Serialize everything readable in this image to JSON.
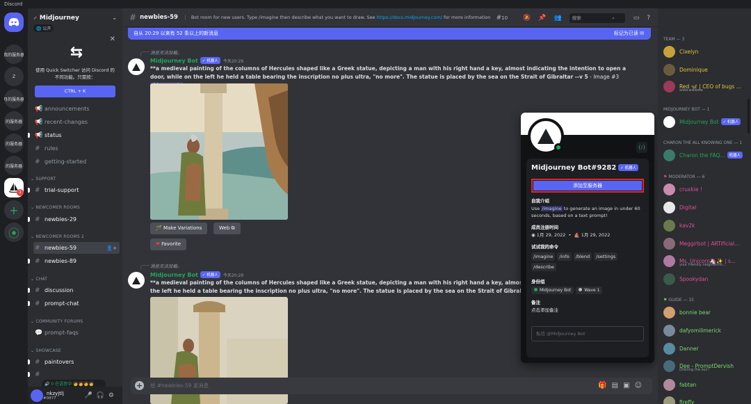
{
  "app": {
    "title": "Discord"
  },
  "rail": {
    "servers": [
      "我的服务器",
      "Z",
      "月的服务器",
      "的服务器",
      "的服务器",
      "的服务器"
    ],
    "active_badge": "1",
    "add": "+",
    "explore": "⦿"
  },
  "guild": {
    "name": "Midjourney",
    "public_tag": "公开",
    "quick_switcher": {
      "text": "使用 Quick Switcher 访问 Discord 的不同功能。只需按：",
      "shortcut": "CTRL + K"
    },
    "channels": [
      {
        "kind": "text",
        "label": "announcements"
      },
      {
        "kind": "text",
        "label": "recent-changes"
      },
      {
        "kind": "text",
        "label": "status"
      },
      {
        "kind": "text",
        "label": "rules"
      },
      {
        "kind": "text",
        "label": "getting-started"
      }
    ],
    "categories": {
      "support": "SUPPORT",
      "newcomer": "NEWCOMER ROOMS",
      "newcomer2": "NEWCOMER ROOMS 2",
      "chat": "CHAT",
      "forums": "COMMUNITY FORUMS",
      "showcase": "SHOWCASE"
    },
    "support_channels": [
      "trial-support"
    ],
    "newcomer_channels": [
      "newbies-29"
    ],
    "newcomer2_channels": [
      "newbies-59",
      "newbies-89"
    ],
    "chat_channels": [
      "discussion",
      "prompt-chat"
    ],
    "forum_channels": [
      "prompt-faqs"
    ],
    "showcase_channels": [
      "paintovers"
    ],
    "voice_status": "0 在语音中"
  },
  "user": {
    "name": "nkzyjtlj",
    "tag": "#0877"
  },
  "channel": {
    "name": "newbies-59",
    "topic_prefix": "Bot room for new users. Type /imagine then describe what you want to draw. See ",
    "topic_link": "https://docs.midjourney.com/",
    "topic_suffix": " for more information",
    "member_count": "10",
    "search_placeholder": "搜索"
  },
  "new_messages": {
    "text": "自从 20:29 以来有 52 条以上的新消息",
    "mark_read": "标记为已读"
  },
  "messages": [
    {
      "reply": "消息无法加载。",
      "author": "Midjourney Bot",
      "bot_badge": "✓ 机器人",
      "time": "今天20:29",
      "text": "**a medieval painting of the columns of Hercules shaped like a Greek statue, depicting a man with his right hand a key, almost indicating the intention to open a door, while on the left he held a table bearing the inscription no plus ultra, \"no more\". The statue is placed by the sea on the Strait of Gibraltar --v 5",
      "suffix": " - Image #3 ",
      "mention": "@lucawario",
      "buttons": {
        "variations": "Make Variations",
        "web": "Web",
        "favorite": "Favorite"
      }
    },
    {
      "reply": "消息无法加载。",
      "author": "Midjourney Bot",
      "bot_badge": "✓ 机器人",
      "time": "今天20:29",
      "text": "**a medieval painting of the columns of Hercules shaped like a Greek statue, depicting a man with his right hand a key, almost indicatin",
      "text2": "the left he held a table bearing the inscription no plus ultra, \"no more\". The statue is placed by the sea on the Strait of Gibraltar --v 5 -"
    }
  ],
  "composer": {
    "placeholder": "给 #newbies-59 发消息"
  },
  "profile": {
    "name": "Midjourney Bot#9282",
    "bot_badge": "✓ 机器人",
    "add_to_server": "添加至服务器",
    "about_heading": "自我介绍",
    "about_cmd": "/imagine",
    "about_text": " to generate an image in under 60 seconds, based on a text prompt!",
    "about_use": "Use ",
    "since_heading": "成员注册时间",
    "since_discord": "1月 29, 2022",
    "since_server": "1月 29, 2022",
    "commands_heading": "试试我的命令",
    "commands": [
      "/imagine",
      "/info",
      "/blend",
      "/settings",
      "/describe"
    ],
    "roles_heading": "身份组",
    "roles": [
      "Midjourney Bot",
      "Wave 1"
    ],
    "note_heading": "备注",
    "note_placeholder": "点击添加备注",
    "message_placeholder": "私信 @Midjourney Bot"
  },
  "members": {
    "categories": [
      "TEAM — 3",
      "MIDJOURNEY BOT — 1",
      "CHARON THE ALL KNOWING ONE — 1",
      "MODERATOR — 6",
      "GUIDE — 15"
    ],
    "list": [
      {
        "name": "Cixelyn",
        "color": "#e3c33f"
      },
      {
        "name": "Dominique",
        "color": "#e3c33f"
      },
      {
        "name": "Red 🦋 | CEO of bugs ...",
        "color": "#e3c33f",
        "sub": "www.wwwww"
      },
      {
        "name": "Midjourney Bot",
        "color": "#23a55a",
        "badge": "✓ 机器人"
      },
      {
        "name": "Charon the FAQ...",
        "color": "#23a55a",
        "badge": "机器人"
      },
      {
        "name": "cruxkie !",
        "color": "#e04f9b"
      },
      {
        "name": "Digital",
        "color": "#e04f9b"
      },
      {
        "name": "kav2k",
        "color": "#e04f9b"
      },
      {
        "name": "Meggirbot | ARTificial...",
        "color": "#e04f9b"
      },
      {
        "name": "Ms. Unicorn🦄✨ | s...",
        "color": "#e04f9b",
        "sub": "your friendly neighborho..."
      },
      {
        "name": "Spookydan",
        "color": "#e04f9b"
      },
      {
        "name": "bonnie bear",
        "color": "#7bd96a"
      },
      {
        "name": "dafyomilimerick",
        "color": "#7bd96a"
      },
      {
        "name": "Danner",
        "color": "#7bd96a"
      },
      {
        "name": "Dee - PromptDervish",
        "color": "#7bd96a",
        "sub": "Orbiting the sun."
      },
      {
        "name": "fabtan",
        "color": "#7bd96a"
      },
      {
        "name": "firefly",
        "color": "#7bd96a"
      }
    ]
  }
}
